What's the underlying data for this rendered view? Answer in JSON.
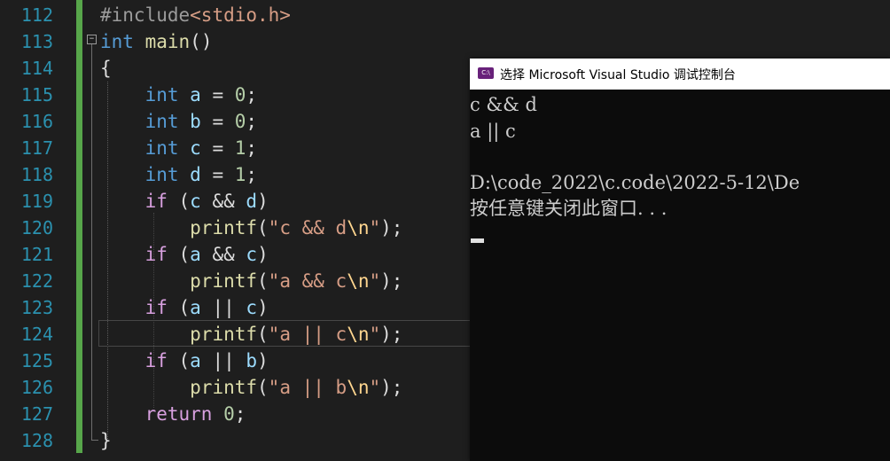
{
  "editor": {
    "lines": [
      {
        "num": "112",
        "tokens": [
          [
            "pp",
            "#include"
          ],
          [
            "inc",
            "<stdio.h>"
          ]
        ]
      },
      {
        "num": "113",
        "tokens": [
          [
            "kw",
            "int"
          ],
          [
            "",
            " "
          ],
          [
            "fn",
            "main"
          ],
          [
            "",
            "()"
          ]
        ]
      },
      {
        "num": "114",
        "tokens": [
          [
            "",
            "{"
          ]
        ]
      },
      {
        "num": "115",
        "tokens": [
          [
            "",
            "    "
          ],
          [
            "kw",
            "int"
          ],
          [
            "",
            " "
          ],
          [
            "var",
            "a"
          ],
          [
            "",
            " = "
          ],
          [
            "num",
            "0"
          ],
          [
            "",
            ";"
          ]
        ]
      },
      {
        "num": "116",
        "tokens": [
          [
            "",
            "    "
          ],
          [
            "kw",
            "int"
          ],
          [
            "",
            " "
          ],
          [
            "var",
            "b"
          ],
          [
            "",
            " = "
          ],
          [
            "num",
            "0"
          ],
          [
            "",
            ";"
          ]
        ]
      },
      {
        "num": "117",
        "tokens": [
          [
            "",
            "    "
          ],
          [
            "kw",
            "int"
          ],
          [
            "",
            " "
          ],
          [
            "var",
            "c"
          ],
          [
            "",
            " = "
          ],
          [
            "num",
            "1"
          ],
          [
            "",
            ";"
          ]
        ]
      },
      {
        "num": "118",
        "tokens": [
          [
            "",
            "    "
          ],
          [
            "kw",
            "int"
          ],
          [
            "",
            " "
          ],
          [
            "var",
            "d"
          ],
          [
            "",
            " = "
          ],
          [
            "num",
            "1"
          ],
          [
            "",
            ";"
          ]
        ]
      },
      {
        "num": "119",
        "tokens": [
          [
            "",
            "    "
          ],
          [
            "ctl",
            "if"
          ],
          [
            "",
            " ("
          ],
          [
            "var",
            "c"
          ],
          [
            "",
            " && "
          ],
          [
            "var",
            "d"
          ],
          [
            "",
            ")"
          ]
        ]
      },
      {
        "num": "120",
        "tokens": [
          [
            "",
            "        "
          ],
          [
            "fn",
            "printf"
          ],
          [
            "",
            "("
          ],
          [
            "str",
            "\"c && d"
          ],
          [
            "esc",
            "\\n"
          ],
          [
            "str",
            "\""
          ],
          [
            "",
            ");"
          ]
        ]
      },
      {
        "num": "121",
        "tokens": [
          [
            "",
            "    "
          ],
          [
            "ctl",
            "if"
          ],
          [
            "",
            " ("
          ],
          [
            "var",
            "a"
          ],
          [
            "",
            " && "
          ],
          [
            "var",
            "c"
          ],
          [
            "",
            ")"
          ]
        ]
      },
      {
        "num": "122",
        "tokens": [
          [
            "",
            "        "
          ],
          [
            "fn",
            "printf"
          ],
          [
            "",
            "("
          ],
          [
            "str",
            "\"a && c"
          ],
          [
            "esc",
            "\\n"
          ],
          [
            "str",
            "\""
          ],
          [
            "",
            ");"
          ]
        ]
      },
      {
        "num": "123",
        "tokens": [
          [
            "",
            "    "
          ],
          [
            "ctl",
            "if"
          ],
          [
            "",
            " ("
          ],
          [
            "var",
            "a"
          ],
          [
            "",
            " || "
          ],
          [
            "var",
            "c"
          ],
          [
            "",
            ")"
          ]
        ]
      },
      {
        "num": "124",
        "tokens": [
          [
            "",
            "        "
          ],
          [
            "fn",
            "printf"
          ],
          [
            "",
            "("
          ],
          [
            "str",
            "\"a || c"
          ],
          [
            "esc",
            "\\n"
          ],
          [
            "str",
            "\""
          ],
          [
            "",
            ");"
          ]
        ]
      },
      {
        "num": "125",
        "tokens": [
          [
            "",
            "    "
          ],
          [
            "ctl",
            "if"
          ],
          [
            "",
            " ("
          ],
          [
            "var",
            "a"
          ],
          [
            "",
            " || "
          ],
          [
            "var",
            "b"
          ],
          [
            "",
            ")"
          ]
        ]
      },
      {
        "num": "126",
        "tokens": [
          [
            "",
            "        "
          ],
          [
            "fn",
            "printf"
          ],
          [
            "",
            "("
          ],
          [
            "str",
            "\"a || b"
          ],
          [
            "esc",
            "\\n"
          ],
          [
            "str",
            "\""
          ],
          [
            "",
            ");"
          ]
        ]
      },
      {
        "num": "127",
        "tokens": [
          [
            "",
            "    "
          ],
          [
            "ctl",
            "return"
          ],
          [
            "",
            " "
          ],
          [
            "num",
            "0"
          ],
          [
            "",
            ";"
          ]
        ]
      },
      {
        "num": "128",
        "tokens": [
          [
            "",
            "}"
          ]
        ]
      }
    ]
  },
  "console": {
    "title": "选择 Microsoft Visual Studio 调试控制台",
    "icon": "terminal-app-icon",
    "output": [
      "c && d",
      "a || c",
      "",
      "D:\\code_2022\\c.code\\2022-5-12\\De",
      "按任意键关闭此窗口. . ."
    ]
  },
  "colors": {
    "background": "#1e1e1e",
    "line_number": "#2b91af",
    "keyword": "#569cd6",
    "function": "#dcdcaa",
    "string": "#d69d85",
    "number": "#b5cea8",
    "variable": "#9cdcfe",
    "control": "#d8a0df",
    "change_bar": "#57a64a",
    "console_bg": "#0c0c0c"
  }
}
